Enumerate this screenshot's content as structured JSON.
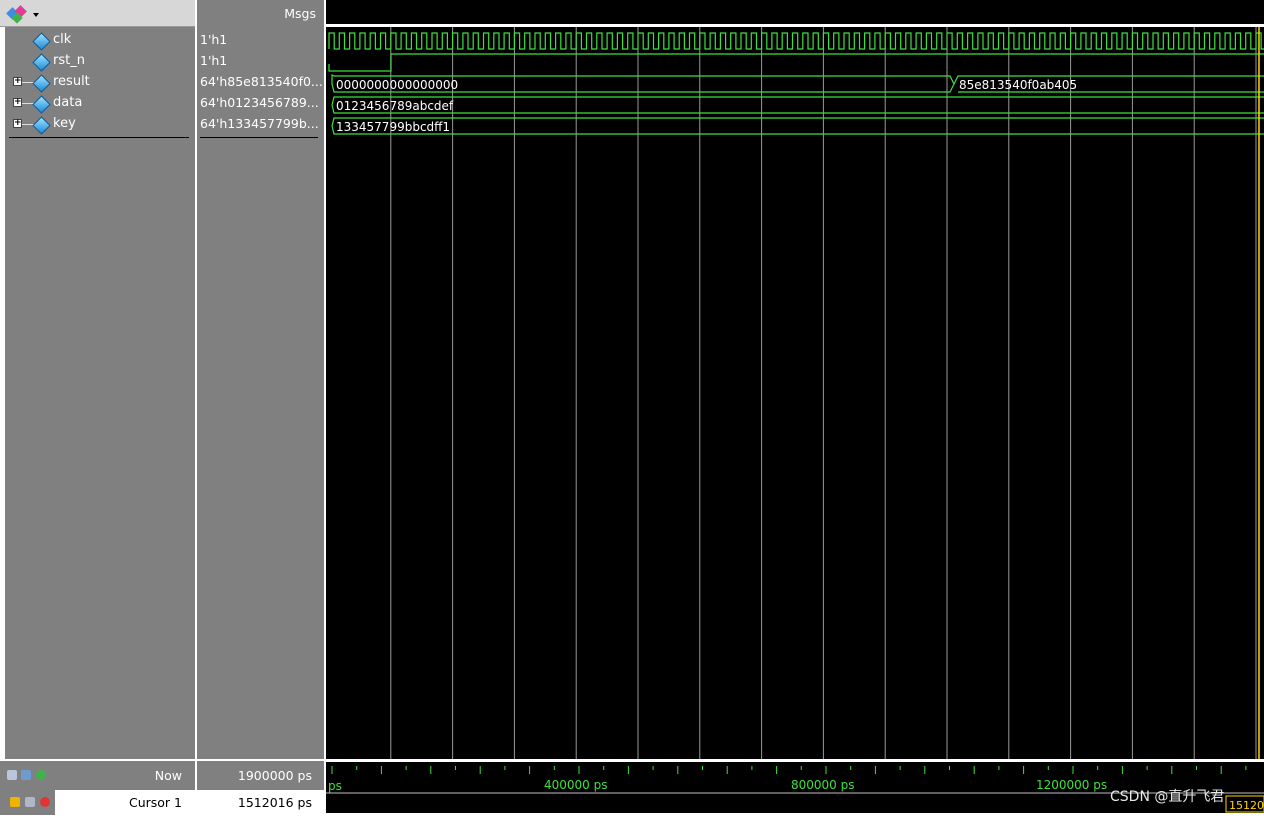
{
  "msgs_header": "Msgs",
  "signals": [
    {
      "name": "clk",
      "value": "1'h1",
      "expandable": false
    },
    {
      "name": "rst_n",
      "value": "1'h1",
      "expandable": false
    },
    {
      "name": "result",
      "value": "64'h85e813540f0...",
      "expandable": true
    },
    {
      "name": "data",
      "value": "64'h0123456789...",
      "expandable": true
    },
    {
      "name": "key",
      "value": "64'h133457799b...",
      "expandable": true
    }
  ],
  "bus_values": {
    "result_initial": "0000000000000000",
    "result_final": "85e813540f0ab405",
    "data": "0123456789abcdef",
    "key": "133457799bbcdff1"
  },
  "footer": {
    "now_label": "Now",
    "now_value": "1900000 ps",
    "cursor_label": "Cursor 1",
    "cursor_value": "1512016 ps"
  },
  "timeline": {
    "partial_left_label": "ps",
    "labels": [
      "400000 ps",
      "800000 ps",
      "1200000 ps"
    ],
    "cursor_tag": "15120"
  },
  "watermark": "CSDN @直升飞君",
  "colors": {
    "wave": "#3ee03e",
    "grid": "#9a9a9a",
    "cursor": "#ffd400"
  }
}
